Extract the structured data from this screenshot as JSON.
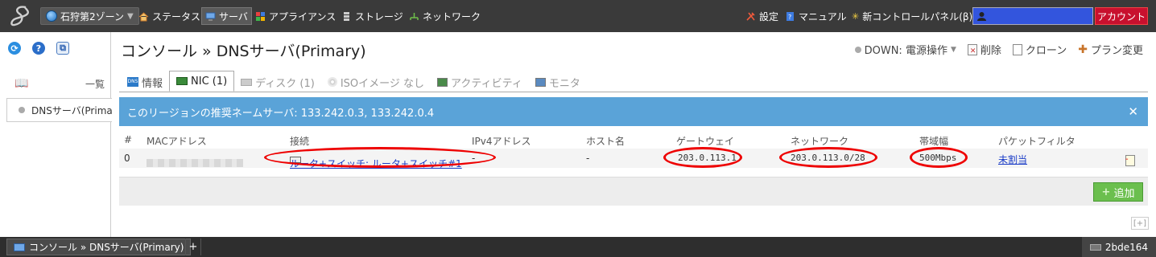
{
  "topbar": {
    "zone": "石狩第2ゾーン",
    "nav": [
      {
        "label": "ステータス",
        "icon": "house-icon"
      },
      {
        "label": "サーバ",
        "icon": "server-icon"
      },
      {
        "label": "アプライアンス",
        "icon": "appliance-icon"
      },
      {
        "label": "ストレージ",
        "icon": "storage-icon"
      },
      {
        "label": "ネットワーク",
        "icon": "network-icon"
      }
    ],
    "settings": "設定",
    "manual": "マニュアル",
    "new_panel": "新コントロールパネル(β)",
    "account": "アカウント"
  },
  "sidebar": {
    "list_label": "一覧",
    "item": "DNSサーバ(Primary)"
  },
  "main": {
    "title": "コンソール » DNSサーバ(Primary)",
    "actions": {
      "status": "DOWN: 電源操作",
      "delete": "削除",
      "clone": "クローン",
      "plan": "プラン変更"
    },
    "tabs": [
      "情報",
      "NIC (1)",
      "ディスク (1)",
      "ISOイメージ なし",
      "アクティビティ",
      "モニタ"
    ],
    "notice": "このリージョンの推奨ネームサーバ: 133.242.0.3, 133.242.0.4",
    "table": {
      "headers": [
        "#",
        "MACアドレス",
        "接続",
        "IPv4アドレス",
        "ホスト名",
        "ゲートウェイ",
        "ネットワーク",
        "帯域幅",
        "パケットフィルタ"
      ],
      "row": {
        "num": "0",
        "connection": "ルータ+スイッチ: ルータ+スイッチ#1",
        "ipv4": "-",
        "hostname": "-",
        "gateway": "203.0.113.1",
        "network": "203.0.113.0/28",
        "bandwidth": "500Mbps",
        "filter": "未割当"
      }
    },
    "add_button": "追加",
    "expand": "[+]"
  },
  "bottombar": {
    "tab": "コンソール » DNSサーバ(Primary)",
    "plus": "+",
    "id": "2bde164"
  },
  "colors": {
    "topbar": "#3a3a3a",
    "notice": "#5aa3d8",
    "account": "#c8102e",
    "add": "#6bbf4e",
    "highlight": "#ee0000"
  }
}
